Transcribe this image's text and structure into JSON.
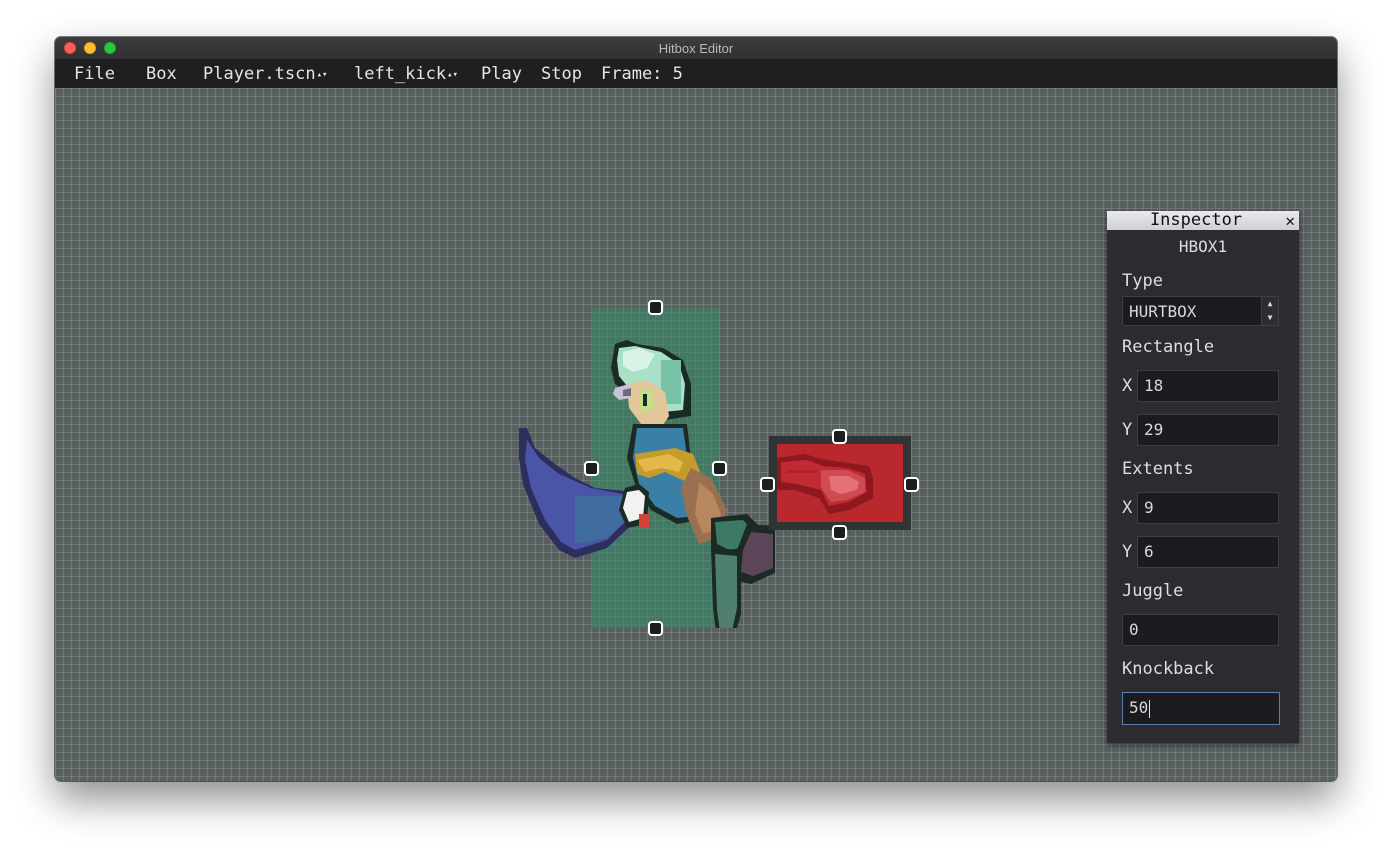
{
  "window": {
    "title": "Hitbox Editor"
  },
  "menubar": {
    "file": "File",
    "box": "Box",
    "scene": "Player.tscn",
    "animation": "left_kick",
    "play": "Play",
    "stop": "Stop",
    "frame": "Frame: 5"
  },
  "inspector": {
    "title": "Inspector",
    "close": "✕",
    "box_name": "HBOX1",
    "type_label": "Type",
    "type_value": "HURTBOX",
    "rectangle_label": "Rectangle",
    "rect_x_label": "X",
    "rect_x": "18",
    "rect_y_label": "Y",
    "rect_y": "29",
    "extents_label": "Extents",
    "ext_x_label": "X",
    "ext_x": "9",
    "ext_y_label": "Y",
    "ext_y": "6",
    "juggle_label": "Juggle",
    "juggle": "0",
    "knockback_label": "Knockback",
    "knockback": "50"
  },
  "colors": {
    "canvas": "#596060",
    "hurtbox": "#328c64",
    "hitbox": "#b8282d"
  },
  "icons": {
    "close": "close-icon",
    "updown": "updown-arrows-icon"
  }
}
